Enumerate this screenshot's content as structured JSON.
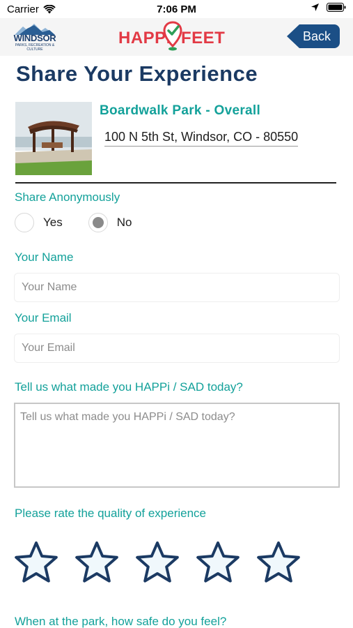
{
  "status_bar": {
    "carrier": "Carrier",
    "time": "7:06 PM"
  },
  "header": {
    "windsor_logo": {
      "name": "WINDSOR",
      "subtitle": "PARKS, RECREATION & CULTURE"
    },
    "happi_logo": {
      "left": "HAPPi",
      "right": "FEET"
    },
    "back_label": "Back"
  },
  "page_title": "Share Your Experience",
  "park": {
    "name": "Boardwalk Park - Overall",
    "address": "100 N 5th St, Windsor, CO - 80550"
  },
  "form": {
    "anonymous_label": "Share Anonymously",
    "anonymous_options": [
      {
        "label": "Yes",
        "selected": false
      },
      {
        "label": "No",
        "selected": true
      }
    ],
    "name_label": "Your Name",
    "name_placeholder": "Your Name",
    "email_label": "Your Email",
    "email_placeholder": "Your Email",
    "feedback_label": "Tell us what made you HAPPi / SAD today?",
    "feedback_placeholder": "Tell us what made you HAPPi / SAD today?",
    "rating_label": "Please rate the quality of experience",
    "rating_value": 0,
    "rating_max": 5,
    "safety_label": "When at the park, how safe do you feel?"
  },
  "colors": {
    "teal": "#13a19a",
    "navy": "#1b3a63",
    "back_button": "#1b4f86",
    "logo_red": "#e23a45",
    "star_fill": "#f0f8fc",
    "star_stroke": "#1b3a63"
  }
}
